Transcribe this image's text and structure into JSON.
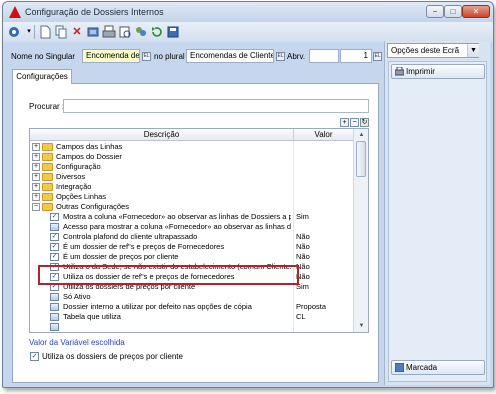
{
  "window": {
    "title": "Configuração de Dossiers Internos",
    "min_glyph": "−",
    "max_glyph": "□",
    "close_glyph": "✕"
  },
  "toolbar": {
    "icons": [
      "menu-icon",
      "new-icon",
      "copy-icon",
      "delete-icon",
      "cut-icon",
      "print-icon",
      "print-preview-icon",
      "group-icon",
      "refresh-icon",
      "save-icon"
    ]
  },
  "fields": {
    "singular_label": "Nome no Singular",
    "singular_value": "Encomenda de Cliente",
    "plural_label": "no plural",
    "plural_value": "Encomendas de Clientes",
    "abrv_label": "Abrv.",
    "abrv_value": "",
    "number_value": "1",
    "lookup_glyph": "EL"
  },
  "right_panel": {
    "combo_value": "Opções deste Ecrã",
    "print_button": "Imprimir",
    "marked_button": "Marcada"
  },
  "tab": {
    "label": "Configurações"
  },
  "search": {
    "label": "Procurar :",
    "value": ""
  },
  "grid": {
    "col_description": "Descrição",
    "col_value": "Valor",
    "rows": [
      {
        "type": "folder",
        "expand": "+",
        "text": "Campos das Linhas",
        "value": ""
      },
      {
        "type": "folder",
        "expand": "+",
        "text": "Campos do Dossier",
        "value": ""
      },
      {
        "type": "folder",
        "expand": "+",
        "text": "Configuração",
        "value": ""
      },
      {
        "type": "folder",
        "expand": "+",
        "text": "Diversos",
        "value": ""
      },
      {
        "type": "folder",
        "expand": "+",
        "text": "Integração",
        "value": ""
      },
      {
        "type": "folder",
        "expand": "+",
        "text": "Opções Linhas",
        "value": ""
      },
      {
        "type": "folder",
        "expand": "−",
        "text": "Outras Configurações",
        "value": ""
      },
      {
        "type": "check",
        "text": "Mostra a coluna «Fornecedor» ao observar as linhas de Dossiers a p...",
        "value": "Sim"
      },
      {
        "type": "doc",
        "text": "Acesso para mostrar a coluna «Fornecedor» ao observar as linhas de...",
        "value": ""
      },
      {
        "type": "check",
        "text": "Controla plafond do cliente ultrapassado",
        "value": "Não"
      },
      {
        "type": "check",
        "text": "É um dossier de ref\"s e preços de Fornecedores",
        "value": "Não"
      },
      {
        "type": "check",
        "text": "É um dossier de preços por cliente",
        "value": "Não"
      },
      {
        "type": "check",
        "text": "Utiliza o da Sede, se não existir do estabelecimento (comum Clientes)...",
        "value": "Não"
      },
      {
        "type": "check",
        "text": "Utiliza os dossier de ref\"s e preços de fornecedores",
        "value": "Não"
      },
      {
        "type": "check",
        "text": "Utiliza os dossiers de preços por cliente",
        "value": "Sim"
      },
      {
        "type": "doc",
        "text": "Só Ativo",
        "value": ""
      },
      {
        "type": "doc",
        "text": "Dossier interno a utilizar por defeito nas opções de cópia",
        "value": "Proposta"
      },
      {
        "type": "doc",
        "text": "Tabela que utiliza",
        "value": "CL"
      },
      {
        "type": "doc",
        "text": "",
        "value": ""
      }
    ]
  },
  "footer": {
    "note": "Valor da Variável escolhida",
    "checkbox_label": "Utiliza os dossiers de preços por cliente",
    "checkbox_checked": "✓"
  },
  "colors": {
    "highlight_border": "#b4222a",
    "note_text": "#2844c8",
    "field_yellow": "#fbfbc9"
  }
}
